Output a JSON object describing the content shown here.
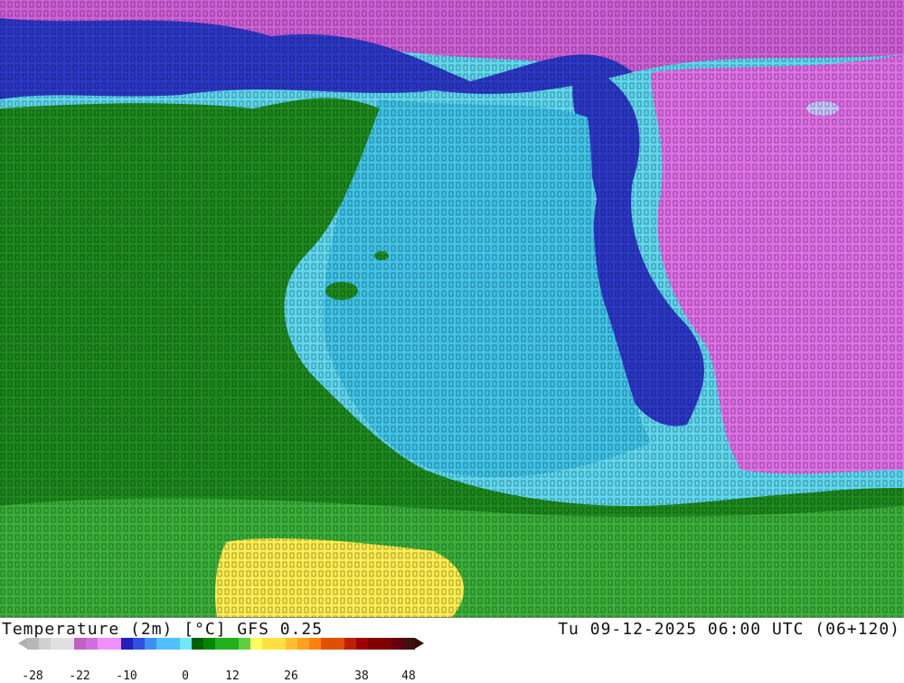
{
  "map": {
    "title": "Temperature (2m) [°C] GFS 0.25",
    "valid_time": "Tu 09-12-2025 06:00 UTC (06+120)"
  },
  "legend": {
    "colors": [
      "#b8b8b8",
      "#d0d0d0",
      "#e0e0e0",
      "#c060c0",
      "#d070e0",
      "#f090ff",
      "#2020c0",
      "#3050e0",
      "#4090f0",
      "#50c0ff",
      "#70e8ff",
      "#006000",
      "#008800",
      "#20b020",
      "#60d040",
      "#ffff60",
      "#ffe040",
      "#ffc030",
      "#ffa020",
      "#ff8010",
      "#e05000",
      "#c02000",
      "#a00000",
      "#800000",
      "#600010",
      "#401010"
    ],
    "ticks": [
      {
        "label": "-28",
        "index": 0
      },
      {
        "label": "-22",
        "index": 4
      },
      {
        "label": "-10",
        "index": 8
      },
      {
        "label": "0",
        "index": 13
      },
      {
        "label": "12",
        "index": 17
      },
      {
        "label": "26",
        "index": 22
      },
      {
        "label": "38",
        "index": 28
      },
      {
        "label": "48",
        "index": 32
      }
    ]
  }
}
